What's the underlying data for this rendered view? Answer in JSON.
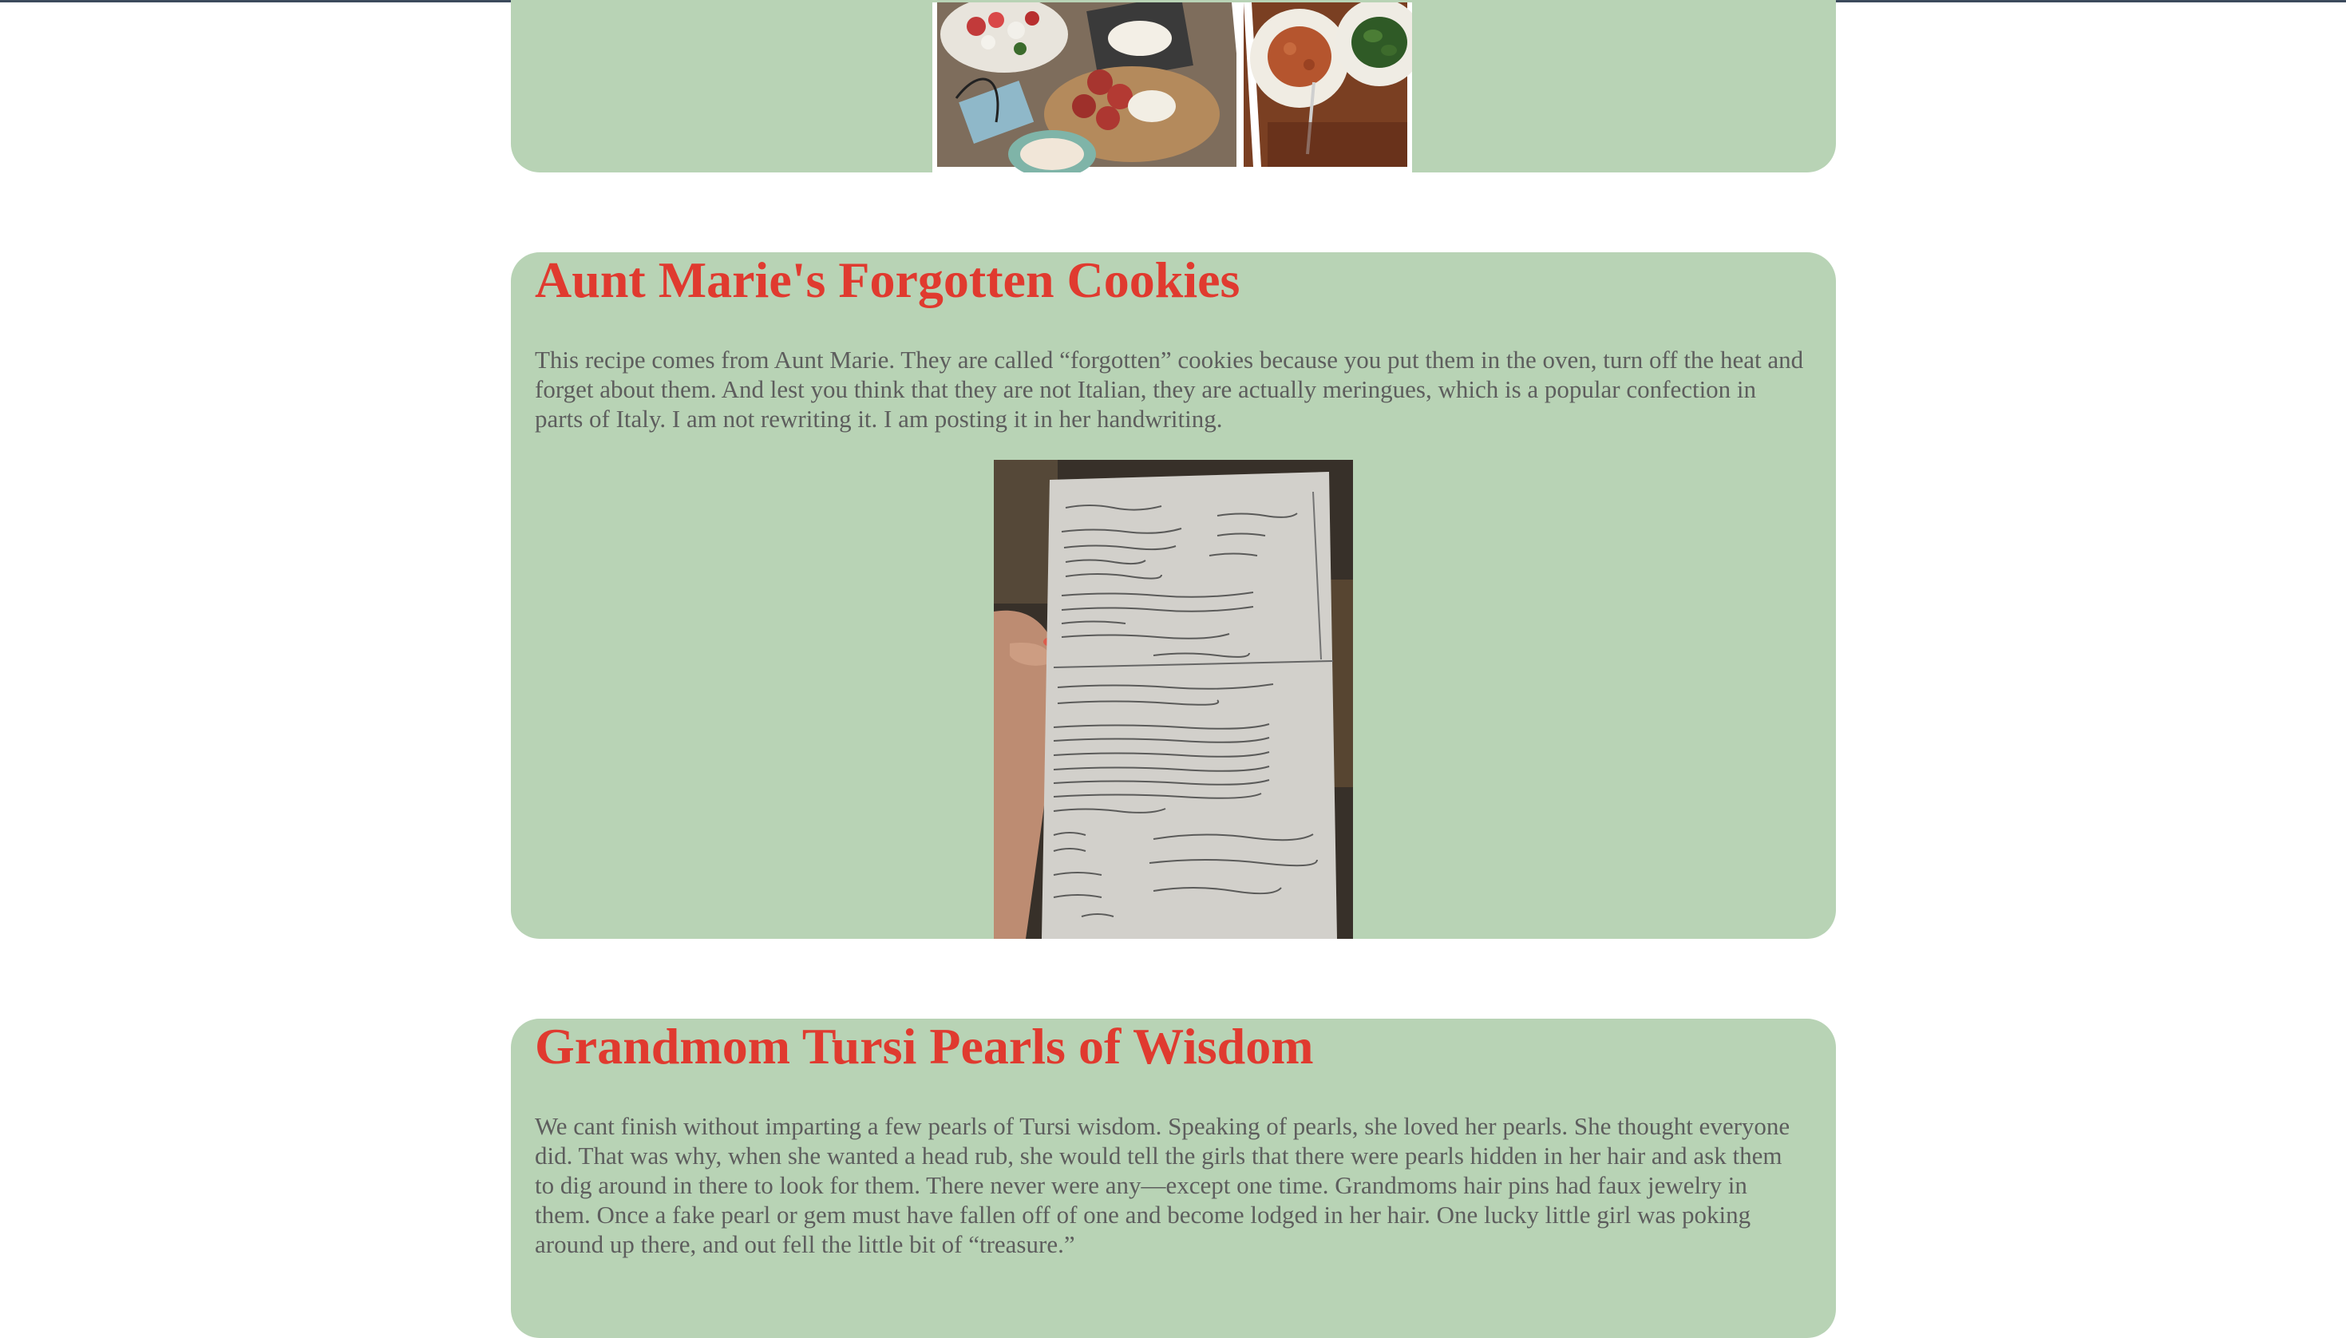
{
  "sections": [
    {
      "id": "top",
      "image_alt": "antipasto platter and pasta dishes"
    },
    {
      "id": "cookies",
      "title": "Aunt Marie's Forgotten Cookies",
      "body": "This recipe comes from Aunt Marie. They are called “forgotten” cookies because you put them in the oven, turn off the heat and forget about them. And lest you think that they are not Italian, they are actually meringues, which is a popular confection in parts of Italy. I am not rewriting it. I am posting it in her handwriting.",
      "image_alt": "handwritten recipe card"
    },
    {
      "id": "wisdom",
      "title": "Grandmom Tursi Pearls of Wisdom",
      "body": "We cant finish without imparting a few pearls of Tursi wisdom. Speaking of pearls, she loved her pearls. She thought everyone did. That was why, when she wanted a head rub, she would tell the girls that there were pearls hidden in her hair and ask them to dig around in there to look for them. There never were any—except one time. Grandmoms hair pins had faux jewelry in them. Once a fake pearl or gem must have fallen off of one and become lodged in her hair. One lucky little girl was poking around up there, and out fell the little bit of “treasure.”"
    }
  ],
  "colors": {
    "card_background": "#b8d3b5",
    "heading": "#e03a2f",
    "body_text": "#5d5d5d",
    "page_background": "#ffffff"
  }
}
